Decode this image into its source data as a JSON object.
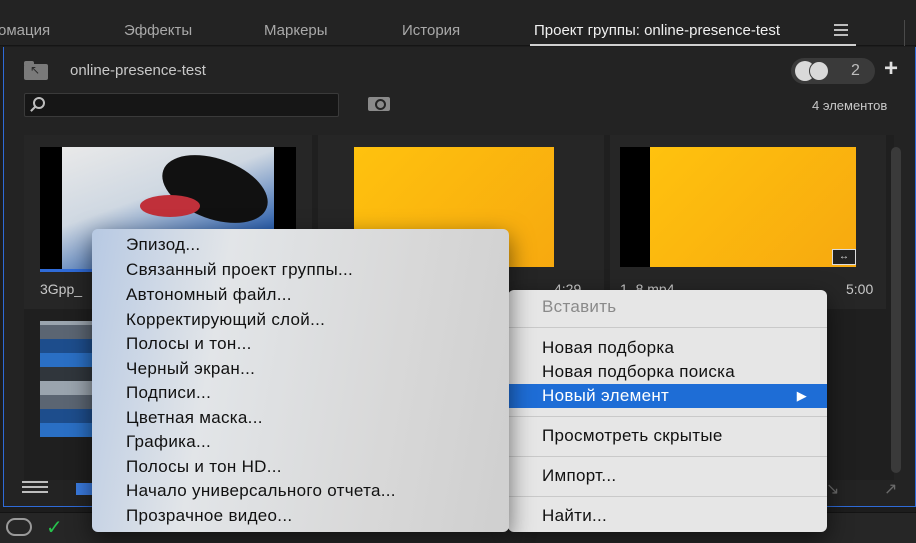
{
  "tabs": [
    {
      "label": "омация",
      "active": false
    },
    {
      "label": "Эффекты",
      "active": false
    },
    {
      "label": "Маркеры",
      "active": false
    },
    {
      "label": "История",
      "active": false
    },
    {
      "label": "Проект группы: online-presence-test",
      "active": true
    }
  ],
  "project": {
    "name": "online-presence-test",
    "collaborators_count": "2",
    "item_count": "4 элементов"
  },
  "clips": [
    {
      "name": "3Gpp_",
      "duration": "",
      "thumb": "eye"
    },
    {
      "name": "",
      "duration": "4:29",
      "thumb": "yellow"
    },
    {
      "name": "1_8.mp4",
      "duration": "5:00",
      "thumb": "yellow"
    },
    {
      "name": "",
      "duration": "",
      "thumb": "pixels"
    }
  ],
  "new_item_menu": [
    "Эпизод...",
    "Связанный проект группы...",
    "Автономный файл...",
    "Корректирующий слой...",
    "Полосы и тон...",
    "Черный экран...",
    "Подписи...",
    "Цветная маска...",
    "Графика...",
    "Полосы и тон HD...",
    "Начало универсального отчета...",
    "Прозрачное видео..."
  ],
  "context_menu": {
    "paste": "Вставить",
    "new_bin": "Новая подборка",
    "new_search_bin": "Новая подборка поиска",
    "new_item": "Новый элемент",
    "view_hidden": "Просмотреть скрытые",
    "import": "Импорт...",
    "find": "Найти..."
  },
  "colors": {
    "accent": "#1e6dd6",
    "status_ok": "#27c24c"
  },
  "icons": [
    "search-icon",
    "plus-icon",
    "folder-up-icon",
    "hamburger-menu-icon",
    "list-view-icon",
    "grid-view-icon",
    "creative-cloud-icon",
    "check-icon",
    "submenu-arrow-icon"
  ]
}
